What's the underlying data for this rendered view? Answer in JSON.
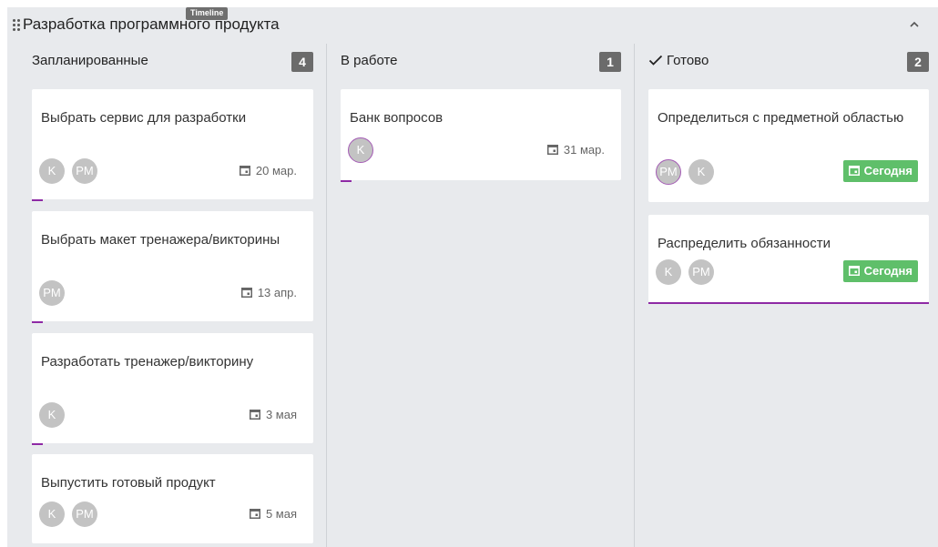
{
  "board": {
    "title": "Разработка программного продукта",
    "timeline_badge": "Timeline"
  },
  "colors": {
    "count_badge": "#6b6b6b",
    "today_badge": "#5fbf6a",
    "accent": "#8e2aa5",
    "avatar": "#c3c3c3"
  },
  "columns": [
    {
      "title": "Запланированные",
      "count": "4",
      "cards": [
        {
          "title": "Выбрать сервис для разработки",
          "avatars": [
            "K",
            "PM"
          ],
          "due": "20 мар."
        },
        {
          "title": "Выбрать макет тренажера/викторины",
          "avatars": [
            "PM"
          ],
          "due": "13 апр."
        },
        {
          "title": "Разработать тренажер/викторину",
          "avatars": [
            "K"
          ],
          "due": "3 мая"
        },
        {
          "title": "Выпустить готовый продукт",
          "avatars": [
            "K",
            "PM"
          ],
          "due": "5 мая"
        }
      ]
    },
    {
      "title": "В работе",
      "count": "1",
      "cards": [
        {
          "title": "Банк вопросов",
          "avatars": [
            "K"
          ],
          "due": "31 мар."
        }
      ]
    },
    {
      "title": "Готово",
      "count": "2",
      "cards": [
        {
          "title": "Определиться с предметной областью",
          "avatars": [
            "PM",
            "K"
          ],
          "due": "Сегодня"
        },
        {
          "title": "Распределить обязанности",
          "avatars": [
            "K",
            "PM"
          ],
          "due": "Сегодня"
        }
      ]
    }
  ]
}
